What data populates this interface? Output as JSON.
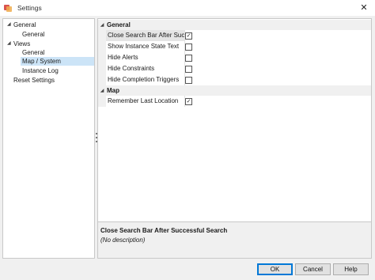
{
  "window": {
    "title": "Settings",
    "close_glyph": "✕"
  },
  "tree": {
    "items": [
      {
        "label": "General",
        "expander": "◢"
      },
      {
        "label": "General"
      },
      {
        "label": "Views",
        "expander": "◢"
      },
      {
        "label": "Map / System",
        "selected": true
      },
      {
        "label": "General"
      },
      {
        "label": "Instance Log"
      },
      {
        "label": "Reset Settings"
      }
    ]
  },
  "properties": {
    "categories": [
      {
        "label": "General",
        "caret": "◢",
        "rows": [
          {
            "name": "Close Search Bar After Successful Search",
            "checked": true,
            "check_glyph": "✓"
          },
          {
            "name": "Show Instance State Text",
            "checked": false,
            "check_glyph": ""
          },
          {
            "name": "Hide Alerts",
            "checked": false,
            "check_glyph": ""
          },
          {
            "name": "Hide Constraints",
            "checked": false,
            "check_glyph": ""
          },
          {
            "name": "Hide Completion Triggers",
            "checked": false,
            "check_glyph": ""
          }
        ]
      },
      {
        "label": "Map",
        "caret": "◢",
        "rows": [
          {
            "name": "Remember Last Location",
            "checked": true,
            "check_glyph": "✓"
          }
        ]
      }
    ]
  },
  "description": {
    "title": "Close Search Bar After Successful Search",
    "text": "(No description)"
  },
  "buttons": {
    "ok": "OK",
    "cancel": "Cancel",
    "help": "Help"
  },
  "colors": {
    "selection": "#cce4f7",
    "default_button_border": "#0078d7"
  }
}
